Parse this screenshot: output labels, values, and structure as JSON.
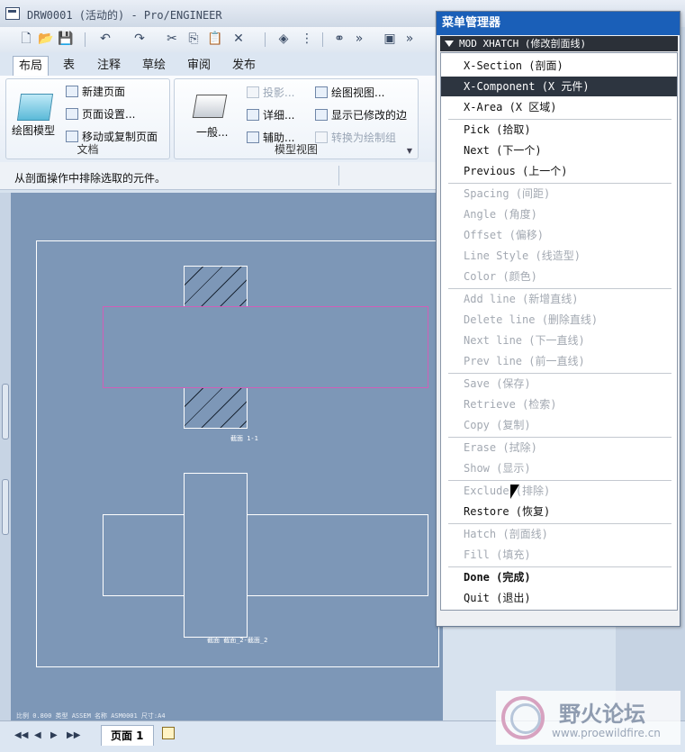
{
  "window": {
    "title": "DRW0001 (活动的) - Pro/ENGINEER"
  },
  "toolbar": {
    "more1": "»",
    "more2": "»"
  },
  "tabs": [
    {
      "label": "布局",
      "active": true
    },
    {
      "label": "表"
    },
    {
      "label": "注释"
    },
    {
      "label": "草绘"
    },
    {
      "label": "审阅"
    },
    {
      "label": "发布"
    }
  ],
  "ribbon": {
    "doc_group": {
      "label": "文档",
      "big_button": "绘图模型",
      "new_page": "新建页面",
      "page_setup": "页面设置...",
      "move_copy": "移动或复制页面"
    },
    "model_view_group": {
      "label": "模型视图",
      "general": "一般...",
      "projection": "投影...",
      "detail": "详细...",
      "auxiliary": "辅助...",
      "drawing_view": "绘图视图...",
      "show_modified_edges": "显示已修改的边",
      "convert_to_draft": "转换为绘制组"
    }
  },
  "status": {
    "message": "从剖面操作中排除选取的元件。"
  },
  "canvas": {
    "section_label_1": "截面 1-1",
    "section_label_2": "截面 截面_2-截面_2",
    "bottom_info": "比例 0.800  类型 ASSEM  名称 ASM0001  尺寸:A4"
  },
  "bottom": {
    "page_tab": "页面 1"
  },
  "menu_manager": {
    "title": "菜单管理器",
    "header": "MOD XHATCH (修改剖面线)",
    "groups": [
      [
        {
          "label": "X-Section (剖面)",
          "enabled": true
        },
        {
          "label": "X-Component (X 元件)",
          "enabled": true,
          "selected": true
        },
        {
          "label": "X-Area (X 区域)",
          "enabled": true
        }
      ],
      [
        {
          "label": "Pick (拾取)",
          "enabled": true
        },
        {
          "label": "Next (下一个)",
          "enabled": true
        },
        {
          "label": "Previous (上一个)",
          "enabled": true
        }
      ],
      [
        {
          "label": "Spacing (间距)",
          "enabled": false
        },
        {
          "label": "Angle (角度)",
          "enabled": false
        },
        {
          "label": "Offset (偏移)",
          "enabled": false
        },
        {
          "label": "Line Style (线造型)",
          "enabled": false
        },
        {
          "label": "Color (颜色)",
          "enabled": false
        }
      ],
      [
        {
          "label": "Add line (新增直线)",
          "enabled": false
        },
        {
          "label": "Delete line (删除直线)",
          "enabled": false
        },
        {
          "label": "Next line (下一直线)",
          "enabled": false
        },
        {
          "label": "Prev line (前一直线)",
          "enabled": false
        }
      ],
      [
        {
          "label": "Save (保存)",
          "enabled": false
        },
        {
          "label": "Retrieve (检索)",
          "enabled": false
        },
        {
          "label": "Copy (复制)",
          "enabled": false
        }
      ],
      [
        {
          "label": "Erase (拭除)",
          "enabled": false
        },
        {
          "label": "Show (显示)",
          "enabled": false
        }
      ],
      [
        {
          "label": "Exclude (排除)",
          "enabled": false
        },
        {
          "label": "Restore (恢复)",
          "enabled": true
        }
      ],
      [
        {
          "label": "Hatch (剖面线)",
          "enabled": false
        },
        {
          "label": "Fill (填充)",
          "enabled": false
        }
      ],
      [
        {
          "label": "Done (完成)",
          "enabled": true,
          "bold": true
        },
        {
          "label": "Quit (退出)",
          "enabled": true
        }
      ]
    ]
  },
  "watermark": {
    "text": "野火论坛",
    "url": "www.proewildfire.cn"
  },
  "colors": {
    "canvas": "#7d97b7",
    "menu_title": "#1a5fb8",
    "selected": "#2d3540",
    "pink_outline": "#d05fb8"
  }
}
